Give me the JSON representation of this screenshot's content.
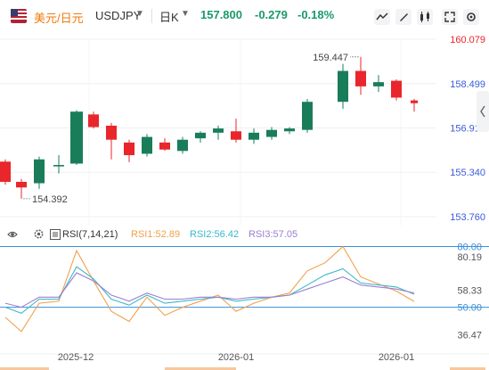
{
  "header": {
    "symbol_label": "美元/日元",
    "pair": "USDJPY",
    "period": "日K",
    "last": "157.800",
    "change": "-0.279",
    "change_pct": "-0.18%"
  },
  "colors": {
    "up": "#1a7d5a",
    "down": "#e8262b",
    "rsi1": "#f2a04a",
    "rsi2": "#3bb8c9",
    "rsi3": "#9b7fd0",
    "level_line": "#3a8fd9",
    "axis_text_red": "#e8262b",
    "axis_text_blue": "#3a5bd9"
  },
  "chart_data": [
    {
      "type": "candlestick",
      "title": "USDJPY 日K",
      "y_ticks": [
        "160.079",
        "158.499",
        "156.919",
        "155.340",
        "153.760"
      ],
      "ylim": [
        153.76,
        160.079
      ],
      "x_ticks": [
        "2025-12",
        "2026-01",
        "2026-01"
      ],
      "annotations": {
        "high": "159.447",
        "low": "154.392"
      },
      "candles": [
        {
          "o": 155.72,
          "h": 155.8,
          "l": 154.9,
          "c": 155.0
        },
        {
          "o": 155.0,
          "h": 155.1,
          "l": 154.4,
          "c": 154.8
        },
        {
          "o": 154.95,
          "h": 155.9,
          "l": 154.75,
          "c": 155.8
        },
        {
          "o": 155.55,
          "h": 155.95,
          "l": 155.3,
          "c": 155.6
        },
        {
          "o": 155.65,
          "h": 157.55,
          "l": 155.6,
          "c": 157.5
        },
        {
          "o": 157.4,
          "h": 157.5,
          "l": 156.9,
          "c": 156.95
        },
        {
          "o": 157.0,
          "h": 157.1,
          "l": 155.8,
          "c": 156.5
        },
        {
          "o": 156.4,
          "h": 156.5,
          "l": 155.7,
          "c": 155.95
        },
        {
          "o": 156.0,
          "h": 156.7,
          "l": 155.9,
          "c": 156.6
        },
        {
          "o": 156.4,
          "h": 156.55,
          "l": 156.1,
          "c": 156.15
        },
        {
          "o": 156.1,
          "h": 156.6,
          "l": 156.0,
          "c": 156.5
        },
        {
          "o": 156.55,
          "h": 156.8,
          "l": 156.4,
          "c": 156.75
        },
        {
          "o": 156.75,
          "h": 157.0,
          "l": 156.5,
          "c": 156.9
        },
        {
          "o": 156.8,
          "h": 157.25,
          "l": 156.4,
          "c": 156.5
        },
        {
          "o": 156.5,
          "h": 156.9,
          "l": 156.35,
          "c": 156.75
        },
        {
          "o": 156.6,
          "h": 156.95,
          "l": 156.5,
          "c": 156.85
        },
        {
          "o": 156.8,
          "h": 156.95,
          "l": 156.7,
          "c": 156.9
        },
        {
          "o": 156.85,
          "h": 157.95,
          "l": 156.75,
          "c": 157.85
        },
        {
          "o": 157.85,
          "h": 159.2,
          "l": 157.6,
          "c": 158.95
        },
        {
          "o": 158.95,
          "h": 159.45,
          "l": 158.1,
          "c": 158.4
        },
        {
          "o": 158.4,
          "h": 158.8,
          "l": 158.2,
          "c": 158.55
        },
        {
          "o": 158.6,
          "h": 158.65,
          "l": 157.9,
          "c": 158.0
        },
        {
          "o": 157.9,
          "h": 157.95,
          "l": 157.5,
          "c": 157.8
        }
      ]
    },
    {
      "type": "line",
      "title": "RSI(7,14,21)",
      "y_ticks": [
        "80.00",
        "80.19",
        "58.33",
        "50.00",
        "36.47"
      ],
      "ylim": [
        30,
        82
      ],
      "levels": [
        80,
        50
      ],
      "series": [
        {
          "name": "RSI1",
          "value_label": "52.89",
          "values": [
            45,
            38,
            52,
            53,
            78,
            63,
            48,
            43,
            55,
            46,
            50,
            53,
            56,
            48,
            52,
            55,
            57,
            68,
            72,
            80,
            65,
            58,
            52.89
          ]
        },
        {
          "name": "RSI2",
          "value_label": "56.42",
          "values": [
            50,
            47,
            54,
            54,
            70,
            64,
            54,
            51,
            56,
            52,
            53,
            54,
            55,
            53,
            54,
            55,
            56,
            61,
            66,
            69,
            62,
            60,
            56.42
          ]
        },
        {
          "name": "RSI3",
          "value_label": "57.05",
          "values": [
            52,
            50,
            55,
            55,
            67,
            63,
            56,
            53,
            57,
            54,
            54,
            55,
            55,
            54,
            55,
            55,
            56,
            59,
            62,
            65,
            61,
            59,
            57.05
          ]
        }
      ]
    }
  ]
}
